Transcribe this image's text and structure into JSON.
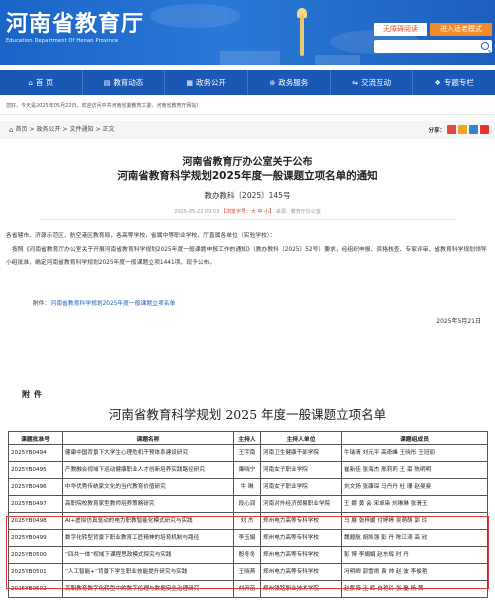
{
  "header": {
    "logo_text": "河南省教育厅",
    "logo_en": "Education Department Of Henan Province",
    "barrier_free_label": "无障碍阅读",
    "old_age_label": "进入适老模式"
  },
  "nav": {
    "items": [
      {
        "icon": "home-icon",
        "glyph": "⌂",
        "label": "首 页"
      },
      {
        "icon": "news-icon",
        "glyph": "▤",
        "label": "教育动态"
      },
      {
        "icon": "affairs-icon",
        "glyph": "▦",
        "label": "政务公开"
      },
      {
        "icon": "service-icon",
        "glyph": "⊛",
        "label": "政务服务"
      },
      {
        "icon": "interact-icon",
        "glyph": "⇋",
        "label": "交流互动"
      },
      {
        "icon": "topic-icon",
        "glyph": "❖",
        "label": "专题专栏"
      }
    ]
  },
  "welcome_text": "您好，今天是2025年05月22日，欢迎访问中共河南省委教育工委、河南省教育厅网站！",
  "breadcrumb": {
    "home": "首页",
    "sep": ">",
    "items": [
      "政务公开",
      "文件通知",
      "正文"
    ]
  },
  "share_label": "分享：",
  "article": {
    "title_line1": "河南省教育厅办公室关于公布",
    "title_line2": "河南省教育科学规划2025年度一般课题立项名单的通知",
    "doc_number": "教办教科〔2025〕145号",
    "meta_date": "2025-05-22 09:03",
    "meta_font_label": "【浏览字号：大 中 小】",
    "meta_source": "来源：教育厅办公室",
    "recipients": "各省辖市、济源示范区、航空港区教育局，各高等学校，省属中等职业学校，厅直属各单位（实验学校）：",
    "body": "按照《河南省教育厅办公室关于开展河南省教育科学规划2025年度一般课题申报工作的通知》（教办教科〔2025〕52号）要求，经组织申报、资格核查、专家评审、省教育科学规划领导小组批准，确定河南省教育科学规划2025年度一般课题立项1441项。现予公布。",
    "attachment_label": "附件：",
    "attachment_link": "河南省教育科学规划2025年度一般课题立项名单",
    "date": "2025年5月21日"
  },
  "document": {
    "fujian": "附件",
    "title": "河南省教育科学规划 2025 年度一般课题立项名单",
    "headers": [
      "课题批准号",
      "课题名称",
      "主持人",
      "主持人单位",
      "课题组成员"
    ],
    "rows": [
      {
        "id": "2025YB0494",
        "name": "健康中国背景下大学生心理危机干预体系建设研究",
        "host": "王宇南",
        "unit": "河南卫生健康干部学院",
        "members": "牛瑞清  刘元平  高奇峰  王晓彤  王冠丽"
      },
      {
        "id": "2025YB0495",
        "name": "产教融合视域下运动健康职业人才创新培养实践路径研究",
        "host": "廉晓宁",
        "unit": "河南女子职业学院",
        "members": "崔新佳  张海杰  邢莉莉  王  甫  陈明明"
      },
      {
        "id": "2025YB0496",
        "name": "中华优秀传统家文化的当代教育价值研究",
        "host": "牛  琳",
        "unit": "河南女子职业学院",
        "members": "刘文扬  张康琛  马丹丹  杜  珊  赵曼曼"
      },
      {
        "id": "2025YB0497",
        "name": "高职院校教育家型教师培养策略研究",
        "host": "段心润",
        "unit": "河南对外经济贸易职业学院",
        "members": "王  娜  黄  会  宋卓染  刘琳琳  张滑玉"
      },
      {
        "id": "2025YB0498",
        "name": "AI+虚拟仿真驱动的电力职教智能化模式研究与实践",
        "host": "刘  杰",
        "unit": "郑州电力高等专科学校",
        "members": "马  展  张梓媛  付婷婷  吴萌萌  郭  玲"
      },
      {
        "id": "2025YB0499",
        "name": "数字化转型背景下职业教育工匠精神的培育机制与路径",
        "host": "李玉娟",
        "unit": "郑州电力高等专科学校",
        "members": "魏顺航  胡凯强  彭  丹  陈江涛  高  欣"
      },
      {
        "id": "2025YB0500",
        "name": "“四共一体”视域下课程思政模式探究与实践",
        "host": "殷冬冬",
        "unit": "郑州电力高等专科学校",
        "members": "彭  博  李娟娟  赵东辉  时  丹"
      },
      {
        "id": "2025YB0501",
        "name": "“人工智能+”背景下学生职业技能提升研究与实践",
        "host": "王晓燕",
        "unit": "郑州电力高等专科学校",
        "members": "冯明卿  郭雪闹  袁  帅  赵  波  李俊艳"
      },
      {
        "id": "2025YB0502",
        "name": "高职教育数字化转型中的数字伦理与数据安全治理研究",
        "host": "刘开苗",
        "unit": "郑州铁路职业技术学院",
        "members": "赵紫薇  王  辉  白艳玲  张  磊  杨  茜"
      }
    ]
  },
  "colors": {
    "banner_blue": "#1b64c7",
    "nav_blue": "#1a58b6",
    "orange": "#f08a2b",
    "highlight_red": "#e23b3b",
    "share_icons": [
      "#e24a3b",
      "#f2a524",
      "#2d86c9",
      "#e5332a"
    ]
  }
}
